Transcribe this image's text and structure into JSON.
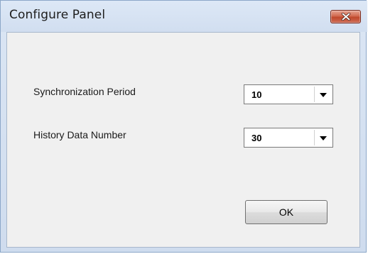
{
  "window": {
    "title": "Configure Panel"
  },
  "form": {
    "sync_period": {
      "label": "Synchronization Period",
      "value": "10"
    },
    "history_number": {
      "label": "History Data Number",
      "value": "30"
    }
  },
  "buttons": {
    "ok_label": "OK"
  },
  "icons": {
    "close": "close-icon",
    "dropdown": "chevron-down-icon"
  },
  "colors": {
    "close_button": "#c0482c",
    "titlebar": "#d1def0",
    "client_background": "#f0f0f0"
  }
}
